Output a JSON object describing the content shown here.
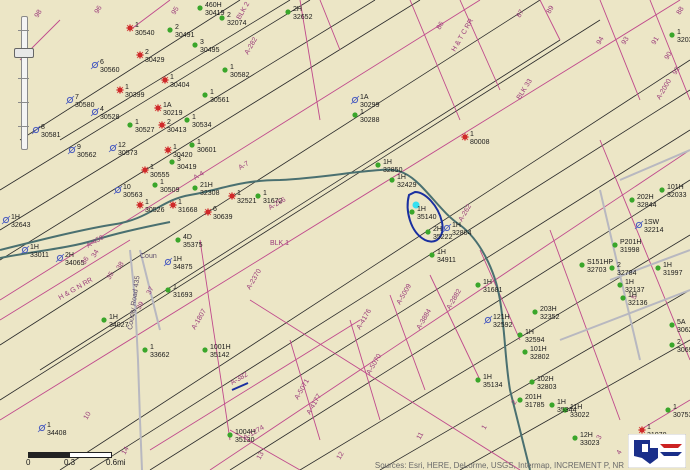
{
  "attribution": "Sources: Esri, HERE, DeLorme, USGS, Intermap, INCREMENT P, NR",
  "scale": {
    "zero": "0",
    "mid": "0.3",
    "end": "0.6mi"
  },
  "colors": {
    "background": "#ece6c6",
    "lease_line": "#c04a8c",
    "survey_line": "#2a2a2a",
    "creek": "#4a7070",
    "road": "#b8b8c0",
    "annotation": "#1a2fa0",
    "highlight": "#35e0f0",
    "oil_well": "#3aa62a",
    "permit_well": "#d02a2a",
    "dry_hole": "#4a5cc0"
  },
  "icons": [
    "zoom-slider-icon",
    "well-symbol-icon",
    "railroad-commission-logo-icon"
  ],
  "survey_labels": [
    "H & T C RR",
    "BLK 33",
    "BLK 1",
    "H & G N RR",
    "A-7",
    "A-262",
    "A-1807",
    "A-2370",
    "A-4176",
    "A-5009",
    "A-5070",
    "A-3884",
    "A-5071",
    "A-4177",
    "A-1274",
    "A-382",
    "A-2882",
    "A-456",
    "A-4",
    "A-256",
    "BLK 2",
    "A-282",
    "A-2000"
  ],
  "grid_labels": [
    "98",
    "95",
    "96",
    "94",
    "93",
    "91",
    "92",
    "90",
    "88",
    "89",
    "87",
    "86",
    "34",
    "35",
    "36",
    "37",
    "39",
    "38",
    "10",
    "14",
    "13",
    "12",
    "11",
    "1",
    "2",
    "3",
    "4",
    "5"
  ],
  "roads": [
    "County Road 435",
    "Coun"
  ],
  "wells": [
    {
      "a": "1",
      "b": "30540"
    },
    {
      "a": "2",
      "b": "30491"
    },
    {
      "a": "3",
      "b": "30495"
    },
    {
      "a": "6",
      "b": "30560"
    },
    {
      "a": "2",
      "b": "30429"
    },
    {
      "a": "1",
      "b": "30582"
    },
    {
      "a": "1",
      "b": "30404"
    },
    {
      "a": "7",
      "b": "30580"
    },
    {
      "a": "1",
      "b": "30399"
    },
    {
      "a": "1",
      "b": "30561"
    },
    {
      "a": "4",
      "b": "30528"
    },
    {
      "a": "1A",
      "b": "30219"
    },
    {
      "a": "1",
      "b": "30527"
    },
    {
      "a": "2",
      "b": "30413"
    },
    {
      "a": "1",
      "b": "30534"
    },
    {
      "a": "8",
      "b": "30581"
    },
    {
      "a": "1",
      "b": "30601"
    },
    {
      "a": "9",
      "b": "30562"
    },
    {
      "a": "12",
      "b": "30573"
    },
    {
      "a": "1",
      "b": "30420"
    },
    {
      "a": "3",
      "b": "30419"
    },
    {
      "a": "1",
      "b": "30555"
    },
    {
      "a": "10",
      "b": "30563"
    },
    {
      "a": "1",
      "b": "30509"
    },
    {
      "a": "1",
      "b": "30526"
    },
    {
      "a": "1",
      "b": "31668"
    },
    {
      "a": "21H",
      "b": "32308"
    },
    {
      "a": "6",
      "b": "30639"
    },
    {
      "a": "1",
      "b": "32521"
    },
    {
      "a": "1",
      "b": "31672"
    },
    {
      "a": "1H",
      "b": "32643"
    },
    {
      "a": "1H",
      "b": "33011"
    },
    {
      "a": "2H",
      "b": "34065"
    },
    {
      "a": "4D",
      "b": "35375"
    },
    {
      "a": "1H",
      "b": "34875"
    },
    {
      "a": "1",
      "b": "31693"
    },
    {
      "a": "1H",
      "b": "34027"
    },
    {
      "a": "1",
      "b": "33662"
    },
    {
      "a": "1001H",
      "b": "35142"
    },
    {
      "a": "1",
      "b": "34408"
    },
    {
      "a": "1004H",
      "b": "35130"
    },
    {
      "a": "460H",
      "b": "30419"
    },
    {
      "a": "2",
      "b": "32074"
    },
    {
      "a": "2H",
      "b": "32652"
    },
    {
      "a": "1A",
      "b": "30299"
    },
    {
      "a": "1",
      "b": "30288"
    },
    {
      "a": "1",
      "b": "80008"
    },
    {
      "a": "1H",
      "b": "32850"
    },
    {
      "a": "1H",
      "b": "32429"
    },
    {
      "a": "1H",
      "b": "35140"
    },
    {
      "a": "2H",
      "b": "35222"
    },
    {
      "a": "1H",
      "b": "32804"
    },
    {
      "a": "1H",
      "b": "34911"
    },
    {
      "a": "1H",
      "b": "31681"
    },
    {
      "a": "121H",
      "b": "32592"
    },
    {
      "a": "1H",
      "b": "32594"
    },
    {
      "a": "203H",
      "b": "32352"
    },
    {
      "a": "101H",
      "b": "32802"
    },
    {
      "a": "102H",
      "b": "32803"
    },
    {
      "a": "201H",
      "b": "31785"
    },
    {
      "a": "1H",
      "b": "35344"
    },
    {
      "a": "11H",
      "b": "33022"
    },
    {
      "a": "12H",
      "b": "33023"
    },
    {
      "a": "1H",
      "b": "35134"
    },
    {
      "a": "1",
      "b": "32031"
    },
    {
      "a": "202H",
      "b": "32844"
    },
    {
      "a": "101H",
      "b": "32033"
    },
    {
      "a": "1SW",
      "b": "32214"
    },
    {
      "a": "P201H",
      "b": "31998"
    },
    {
      "a": "S151HP",
      "b": "32703"
    },
    {
      "a": "2",
      "b": "32784"
    },
    {
      "a": "1H",
      "b": "32137"
    },
    {
      "a": "1H",
      "b": "32136"
    },
    {
      "a": "1H",
      "b": "31997"
    },
    {
      "a": "5A",
      "b": "30629"
    },
    {
      "a": "2",
      "b": "30699"
    },
    {
      "a": "1",
      "b": "30753"
    },
    {
      "a": "1",
      "b": "31070"
    }
  ]
}
